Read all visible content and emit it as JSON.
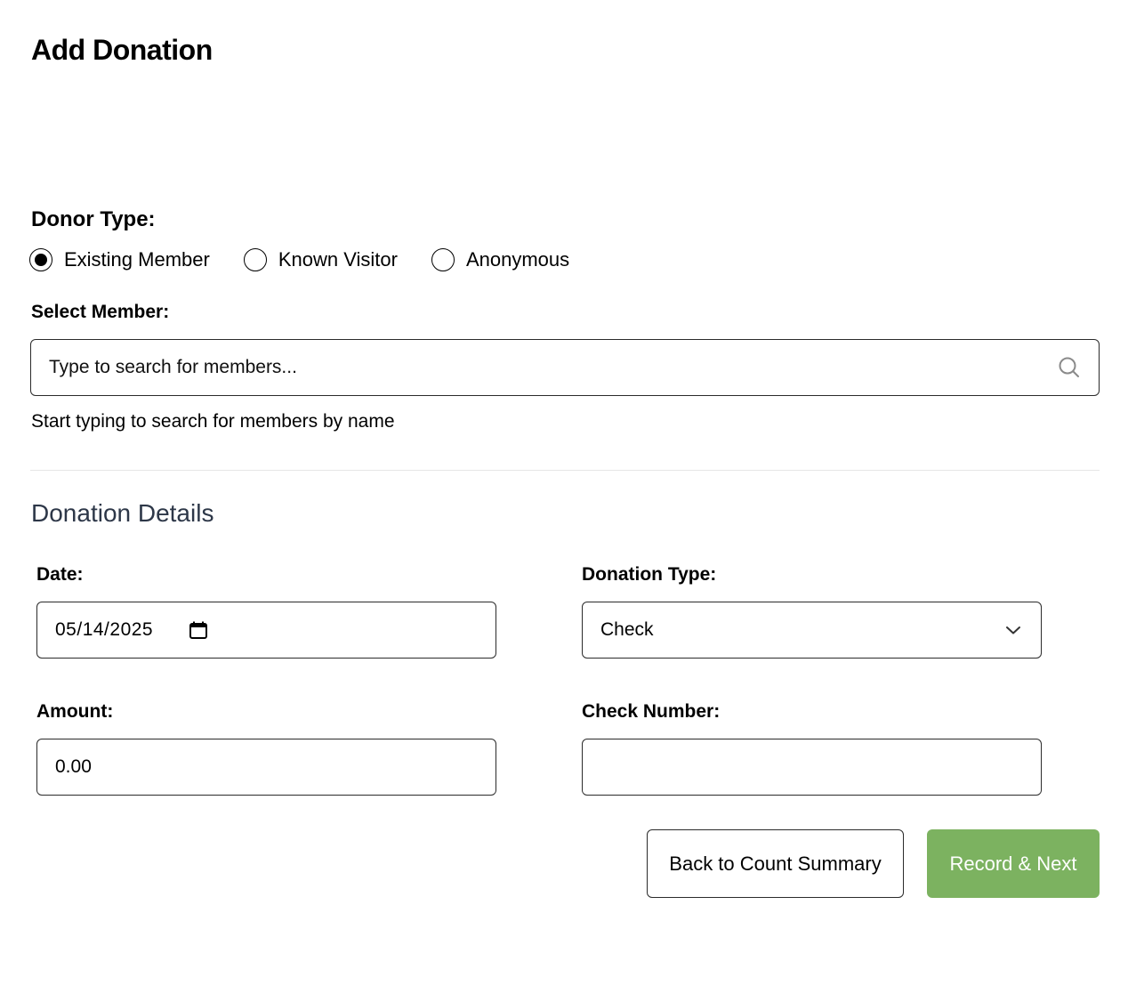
{
  "page": {
    "title": "Add Donation"
  },
  "donor": {
    "label": "Donor Type:",
    "options": [
      {
        "label": "Existing Member",
        "selected": true
      },
      {
        "label": "Known Visitor",
        "selected": false
      },
      {
        "label": "Anonymous",
        "selected": false
      }
    ]
  },
  "member": {
    "label": "Select Member:",
    "placeholder": "Type to search for members...",
    "helper": "Start typing to search for members by name",
    "icon": "search-icon"
  },
  "details": {
    "title": "Donation Details",
    "date": {
      "label": "Date:",
      "value": "05/14/2025",
      "icon": "calendar-icon"
    },
    "type": {
      "label": "Donation Type:",
      "value": "Check",
      "icon": "chevron-down-icon"
    },
    "amount": {
      "label": "Amount:",
      "value": "0.00"
    },
    "check_number": {
      "label": "Check Number:",
      "value": ""
    }
  },
  "actions": {
    "back_label": "Back to Count Summary",
    "record_label": "Record & Next"
  },
  "colors": {
    "primary_button": "#7cb260",
    "section_heading": "#2d3748",
    "divider": "#e6e6e6"
  }
}
